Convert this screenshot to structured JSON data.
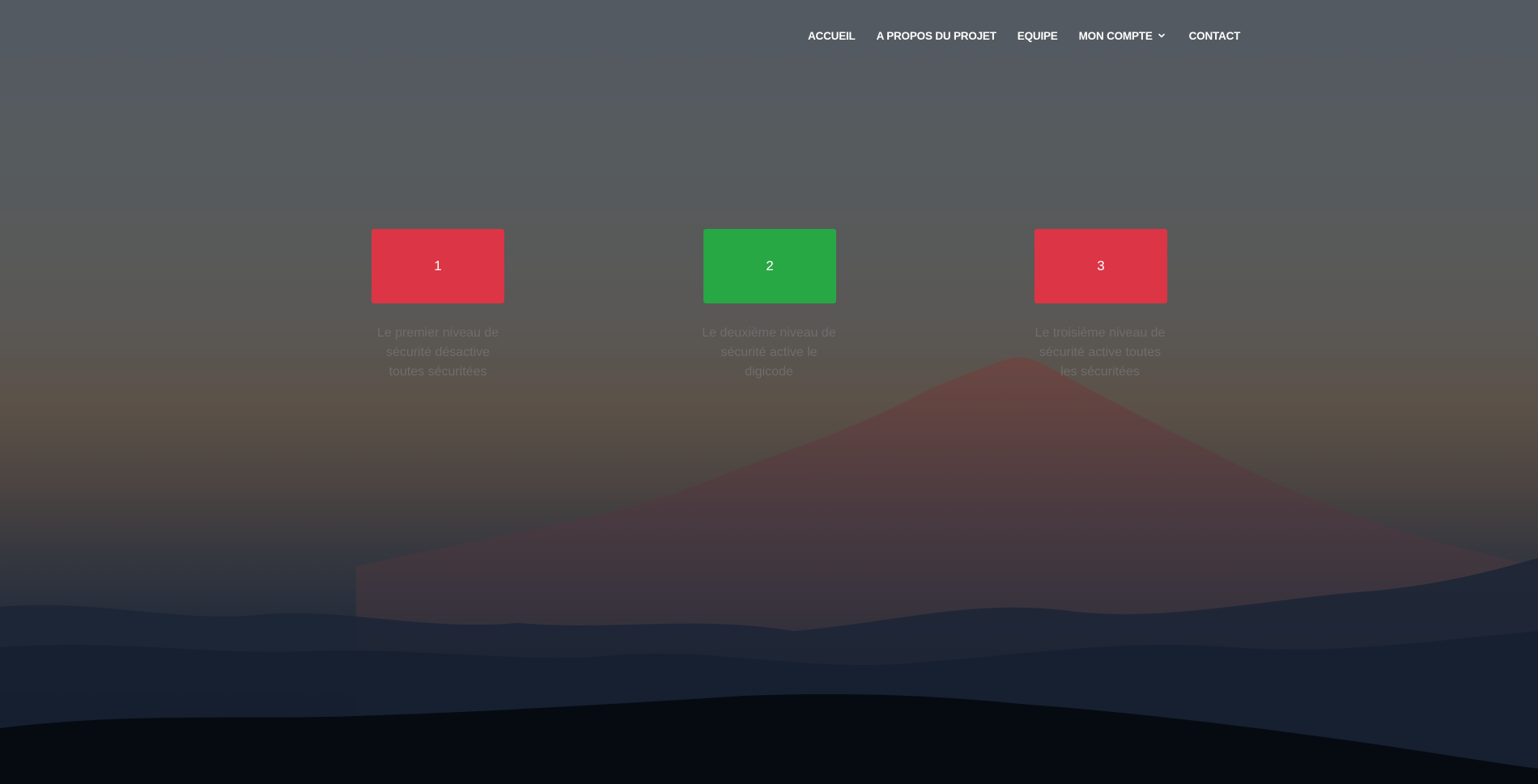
{
  "nav": {
    "items": [
      {
        "label": "ACCUEIL"
      },
      {
        "label": "A PROPOS DU PROJET"
      },
      {
        "label": "EQUIPE"
      },
      {
        "label": "MON COMPTE",
        "icon": "chevron-down-icon"
      },
      {
        "label": "CONTACT"
      }
    ]
  },
  "levels": [
    {
      "label": "1",
      "color": "#dc3545",
      "description": "Le premier niveau de sécurité désactive toutes sécuritées"
    },
    {
      "label": "2",
      "color": "#28a745",
      "description": "Le deuxième niveau de sécurité active le digicode"
    },
    {
      "label": "3",
      "color": "#dc3545",
      "description": "Le troisième niveau de sécurité active toutes les sécuritées"
    }
  ]
}
